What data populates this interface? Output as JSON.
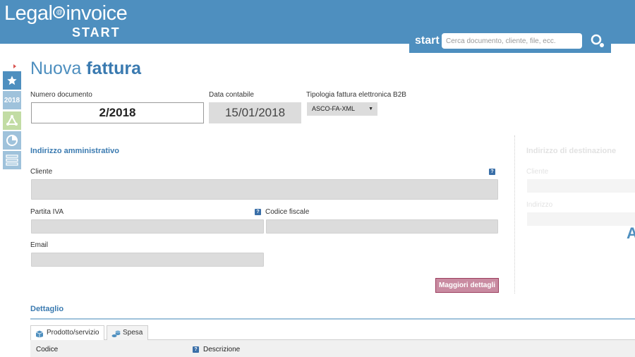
{
  "header": {
    "logo_text_1": "Legal",
    "logo_at": "@",
    "logo_text_2": "invoice",
    "logo_subtitle": "START",
    "search_label": "start",
    "search_placeholder": "Cerca documento, cliente, file, ecc."
  },
  "nav": {
    "year_label": "2018"
  },
  "page": {
    "title_light": "Nuova",
    "title_bold": "fattura"
  },
  "document": {
    "number_label": "Numero documento",
    "number_value": "2/2018",
    "date_label": "Data contabile",
    "date_value": "15/01/2018",
    "b2b_label": "Tipologia fattura elettronica B2B",
    "b2b_value": "ASCO-FA-XML"
  },
  "admin_address": {
    "title": "Indirizzo amministrativo",
    "client_label": "Cliente",
    "vat_label": "Partita IVA",
    "tax_code_label": "Codice fiscale",
    "email_label": "Email",
    "more_button": "Maggiori dettagli",
    "help_glyph": "?"
  },
  "destination": {
    "title": "Indirizzo di destinazione",
    "client_label": "Cliente",
    "address_label": "Indirizzo",
    "edge_letter": "A"
  },
  "detail": {
    "title": "Dettaglio",
    "tabs": [
      {
        "label": "Prodotto/servizio"
      },
      {
        "label": "Spesa"
      }
    ],
    "columns": [
      {
        "label": "Codice"
      },
      {
        "label": "Descrizione"
      }
    ]
  },
  "colors": {
    "brand_blue": "#4e8fbf",
    "button_pink": "#c98ba1"
  },
  "icons": [
    "search-icon",
    "star-icon",
    "triangle-icon",
    "pie-chart-icon",
    "list-icon",
    "box-icon",
    "coins-icon",
    "help-icon"
  ]
}
